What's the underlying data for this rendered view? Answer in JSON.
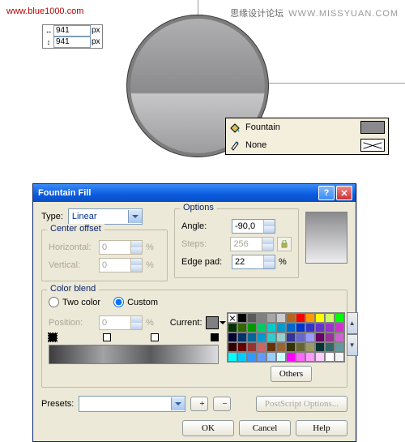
{
  "watermark_left": "www.blue1000.com",
  "watermark_right_cn": "思缘设计论坛",
  "watermark_right_en": "WWW.MISSYUAN.COM",
  "obj_size": {
    "w": "941",
    "w_unit": "px",
    "h": "941",
    "h_unit": "px"
  },
  "tooltip": {
    "fill_label": "Fountain",
    "outline_label": "None"
  },
  "dialog": {
    "title": "Fountain Fill",
    "type_label": "Type:",
    "type_value": "Linear",
    "center_offset": {
      "title": "Center offset",
      "h_label": "Horizontal:",
      "h_value": "0",
      "h_unit": "%",
      "v_label": "Vertical:",
      "v_value": "0",
      "v_unit": "%"
    },
    "options": {
      "title": "Options",
      "angle_label": "Angle:",
      "angle_value": "-90,0",
      "steps_label": "Steps:",
      "steps_value": "256",
      "edge_label": "Edge pad:",
      "edge_value": "22",
      "edge_unit": "%"
    },
    "color_blend": {
      "title": "Color blend",
      "two_color_label": "Two color",
      "custom_label": "Custom",
      "position_label": "Position:",
      "position_value": "0",
      "position_unit": "%",
      "current_label": "Current:",
      "others_label": "Others"
    },
    "presets_label": "Presets:",
    "postscript_label": "PostScript Options...",
    "buttons": {
      "ok": "OK",
      "cancel": "Cancel",
      "help": "Help"
    }
  },
  "palette_colors": [
    "x",
    "#000000",
    "#595959",
    "#808080",
    "#a6a6a6",
    "#cccccc",
    "#b5651d",
    "#ff0000",
    "#ff9900",
    "#ffff00",
    "#ccff66",
    "#00ff00",
    "#003300",
    "#336600",
    "#009900",
    "#00cc66",
    "#00cccc",
    "#0099cc",
    "#0066cc",
    "#0033cc",
    "#3333cc",
    "#6633cc",
    "#9933cc",
    "#cc33cc",
    "#000033",
    "#003366",
    "#006699",
    "#0099cc",
    "#33cccc",
    "#99cccc",
    "#333399",
    "#6666cc",
    "#9999ff",
    "#660066",
    "#993399",
    "#cc66cc",
    "#330000",
    "#660000",
    "#993333",
    "#cc6666",
    "#663300",
    "#996633",
    "#333300",
    "#666633",
    "#999966",
    "#003333",
    "#336666",
    "#669999",
    "#00ffff",
    "#00ccff",
    "#3399ff",
    "#6699ff",
    "#99ccff",
    "#ccffff",
    "#ff00ff",
    "#ff66ff",
    "#ff99ff",
    "#ffccff",
    "#ffffff",
    "#f2f2f2"
  ]
}
